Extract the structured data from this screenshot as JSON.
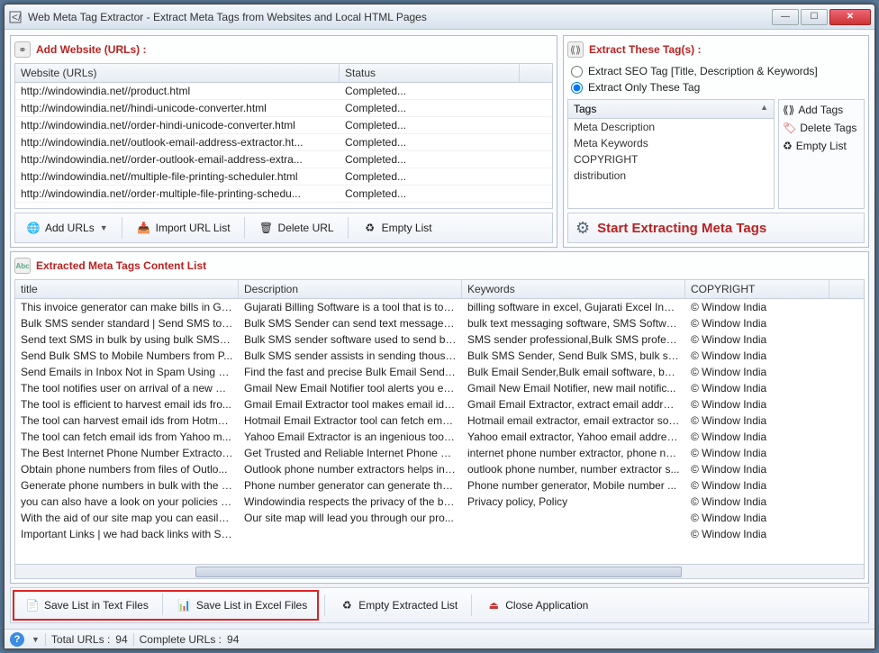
{
  "window": {
    "title": "Web Meta Tag Extractor - Extract Meta Tags from Websites and Local HTML Pages"
  },
  "addUrls": {
    "header": "Add Website (URLs) :",
    "cols": {
      "url": "Website (URLs)",
      "status": "Status"
    },
    "rows": [
      {
        "url": "http://windowindia.net//product.html",
        "status": "Completed..."
      },
      {
        "url": "http://windowindia.net//hindi-unicode-converter.html",
        "status": "Completed..."
      },
      {
        "url": "http://windowindia.net//order-hindi-unicode-converter.html",
        "status": "Completed..."
      },
      {
        "url": "http://windowindia.net//outlook-email-address-extractor.ht...",
        "status": "Completed..."
      },
      {
        "url": "http://windowindia.net//order-outlook-email-address-extra...",
        "status": "Completed..."
      },
      {
        "url": "http://windowindia.net//multiple-file-printing-scheduler.html",
        "status": "Completed..."
      },
      {
        "url": "http://windowindia.net//order-multiple-file-printing-schedu...",
        "status": "Completed..."
      }
    ],
    "btns": {
      "add": "Add URLs",
      "import": "Import URL List",
      "delete": "Delete URL",
      "empty": "Empty List"
    }
  },
  "extractTags": {
    "header": "Extract These Tag(s) :",
    "radio1": "Extract SEO Tag [Title, Description & Keywords]",
    "radio2": "Extract Only These Tag",
    "tagsHeader": "Tags",
    "tags": [
      "Meta Description",
      "Meta Keywords",
      "COPYRIGHT",
      "distribution"
    ],
    "btns": {
      "add": "Add Tags",
      "del": "Delete Tags",
      "empty": "Empty List"
    },
    "start": "Start Extracting Meta Tags"
  },
  "results": {
    "header": "Extracted Meta Tags Content List",
    "cols": {
      "title": "title",
      "desc": "Description",
      "kw": "Keywords",
      "copy": "COPYRIGHT"
    },
    "rows": [
      {
        "t": "This invoice generator can make bills in Guj...",
        "d": "Gujarati Billing Software is a tool that is tota...",
        "k": "billing software in excel, Gujarati Excel Invoi...",
        "c": "©   Window India"
      },
      {
        "t": "Bulk SMS sender standard | Send SMS to m...",
        "d": "Bulk SMS Sender can send text messages in ...",
        "k": "bulk text messaging software, SMS Softwar...",
        "c": "©   Window India"
      },
      {
        "t": "Send text SMS in bulk by using bulk SMS se...",
        "d": "Bulk SMS sender software used to send bul...",
        "k": "SMS sender professional,Bulk SMS professi...",
        "c": "©   Window India"
      },
      {
        "t": "Send Bulk SMS to Mobile Numbers from P...",
        "d": "Bulk SMS sender assists in sending thousan...",
        "k": "Bulk SMS Sender, Send Bulk SMS, bulk sms,...",
        "c": "©   Window India"
      },
      {
        "t": "Send Emails in Inbox Not in Spam Using Bu...",
        "d": "Find the fast and precise Bulk Email Sender ...",
        "k": "Bulk Email Sender,Bulk email software, bulk...",
        "c": "©   Window India"
      },
      {
        "t": "The tool notifies user on arrival of a new m...",
        "d": "Gmail New Email Notifier tool alerts you ev...",
        "k": "Gmail New Email Notifier, new mail notific...",
        "c": "©   Window India"
      },
      {
        "t": "The tool is efficient to harvest email ids fro...",
        "d": "Gmail Email Extractor tool makes email ids ...",
        "k": "Gmail Email Extractor, extract email address...",
        "c": "©   Window India"
      },
      {
        "t": "The tool can harvest email ids from Hotmai...",
        "d": "Hotmail Email Extractor tool can fetch emai...",
        "k": "Hotmail email extractor, email extractor sof...",
        "c": "©   Window India"
      },
      {
        "t": "The tool can fetch email ids from Yahoo m...",
        "d": "Yahoo Email Extractor is an ingenious tool ...",
        "k": "Yahoo email extractor, Yahoo email address...",
        "c": "©   Window India"
      },
      {
        "t": "The Best Internet Phone Number Extractor ...",
        "d": "Get Trusted and Reliable Internet Phone Nu...",
        "k": "internet phone number extractor, phone nu...",
        "c": "©   Window India"
      },
      {
        "t": "Obtain phone numbers from files of Outlo...",
        "d": "Outlook phone number extractors helps in ...",
        "k": "outlook phone number, number extractor s...",
        "c": "©   Window India"
      },
      {
        "t": "Generate phone numbers in bulk with the P...",
        "d": "Phone number generator can generate tho...",
        "k": "Phone number generator, Mobile number ...",
        "c": "©   Window India"
      },
      {
        "t": "you can also have a look on your policies a...",
        "d": "Windowindia respects the privacy of the bu...",
        "k": "Privacy policy, Policy",
        "c": "©   Window India"
      },
      {
        "t": "With the aid of our site map you can easily ...",
        "d": "Our site map will lead you through our pro...",
        "k": "",
        "c": "©   Window India"
      },
      {
        "t": "Important Links | we had back links with So...",
        "d": "",
        "k": "",
        "c": "©   Window India"
      }
    ]
  },
  "bottom": {
    "saveTxt": "Save List in Text Files",
    "saveXls": "Save List in Excel Files",
    "empty": "Empty Extracted List",
    "close": "Close Application"
  },
  "status": {
    "totalLbl": "Total URLs :",
    "total": "94",
    "compLbl": "Complete URLs :",
    "comp": "94"
  }
}
